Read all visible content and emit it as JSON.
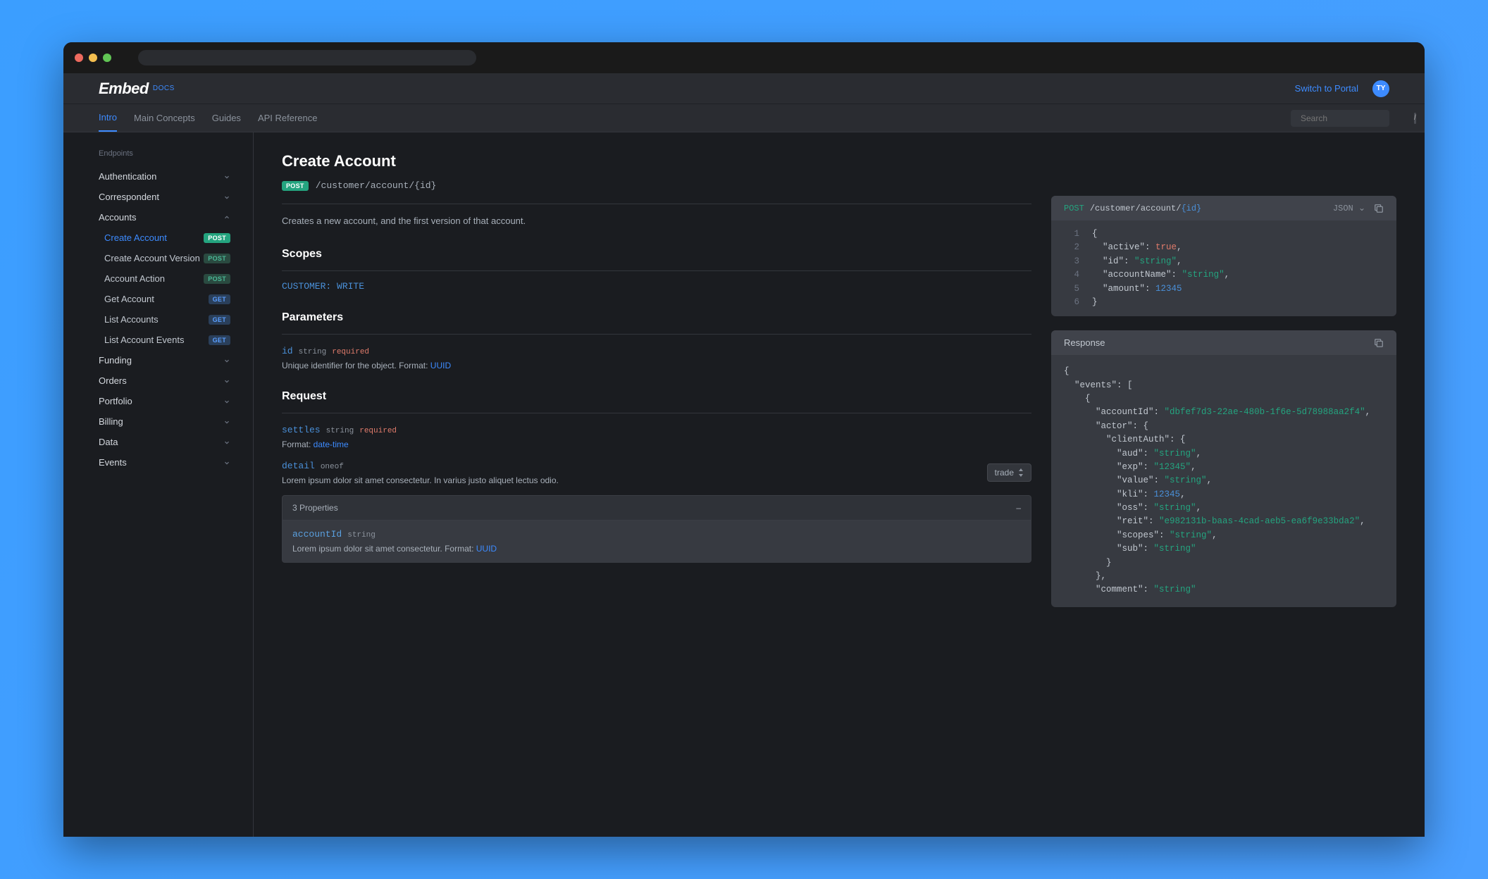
{
  "header": {
    "logo": "Embed",
    "logo_sub": "DOCS",
    "portal_link": "Switch to Portal",
    "avatar_initials": "TY"
  },
  "nav": {
    "items": [
      "Intro",
      "Main Concepts",
      "Guides",
      "API Reference"
    ],
    "active_index": 0,
    "search_placeholder": "Search",
    "search_kbd": "/"
  },
  "sidebar": {
    "section_label": "Endpoints",
    "groups": [
      {
        "label": "Authentication",
        "expanded": false
      },
      {
        "label": "Correspondent",
        "expanded": false
      },
      {
        "label": "Accounts",
        "expanded": true,
        "children": [
          {
            "label": "Create Account",
            "method": "POST",
            "active": true
          },
          {
            "label": "Create Account Version",
            "method": "POST"
          },
          {
            "label": "Account Action",
            "method": "POST"
          },
          {
            "label": "Get Account",
            "method": "GET"
          },
          {
            "label": "List Accounts",
            "method": "GET"
          },
          {
            "label": "List Account Events",
            "method": "GET"
          }
        ]
      },
      {
        "label": "Funding",
        "expanded": false
      },
      {
        "label": "Orders",
        "expanded": false
      },
      {
        "label": "Portfolio",
        "expanded": false
      },
      {
        "label": "Billing",
        "expanded": false
      },
      {
        "label": "Data",
        "expanded": false
      },
      {
        "label": "Events",
        "expanded": false
      }
    ]
  },
  "page": {
    "title": "Create Account",
    "method": "POST",
    "path": "/customer/account/{id}",
    "description": "Creates a new account, and the first version of that account.",
    "scopes_heading": "Scopes",
    "scope": "CUSTOMER: WRITE",
    "parameters_heading": "Parameters",
    "param_id": {
      "name": "id",
      "type": "string",
      "required": "required",
      "desc": "Unique identifier for the object. Format: ",
      "format_link": "UUID"
    },
    "request_heading": "Request",
    "param_settles": {
      "name": "settles",
      "type": "string",
      "required": "required",
      "desc_prefix": "Format: ",
      "format_link": "date-time"
    },
    "param_detail": {
      "name": "detail",
      "type": "oneof",
      "desc": "Lorem ipsum dolor sit amet consectetur. In varius justo aliquet lectus odio.",
      "select_value": "trade"
    },
    "props": {
      "header": "3 Properties",
      "accountId": {
        "name": "accountId",
        "type": "string",
        "desc": "Lorem ipsum dolor sit amet consectetur. Format: ",
        "format_link": "UUID"
      }
    }
  },
  "request_code": {
    "method": "POST",
    "path_prefix": "/customer/account/",
    "path_id": "{id}",
    "format_label": "JSON",
    "lines": [
      "{",
      "  \"active\": true,",
      "  \"id\": \"string\",",
      "  \"accountName\": \"string\",",
      "  \"amount\": 12345",
      "}"
    ]
  },
  "response": {
    "title": "Response",
    "body": "{\n  \"events\": [\n    {\n      \"accountId\": \"dbfef7d3-22ae-480b-1f6e-5d78988aa2f4\",\n      \"actor\": {\n        \"clientAuth\": {\n          \"aud\": \"string\",\n          \"exp\": \"12345\",\n          \"value\": \"string\",\n          \"kli\": 12345,\n          \"oss\": \"string\",\n          \"reit\": \"e982131b-baas-4cad-aeb5-ea6f9e33bda2\",\n          \"scopes\": \"string\",\n          \"sub\": \"string\"\n        }\n      },\n      \"comment\": \"string\""
  }
}
